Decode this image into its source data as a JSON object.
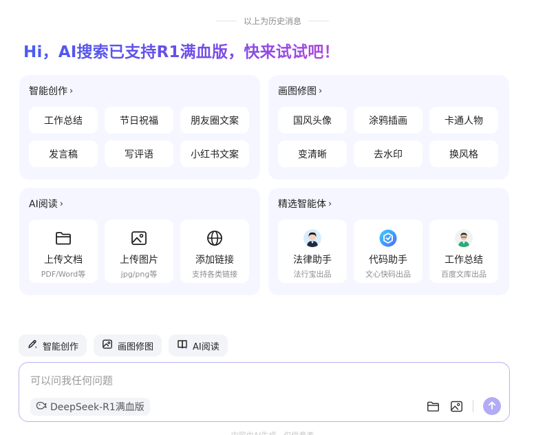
{
  "history_divider": "以上为历史消息",
  "headline": "Hi，AI搜索已支持R1满血版，快来试试吧！",
  "cards": {
    "creation": {
      "title": "智能创作",
      "chips": [
        "工作总结",
        "节日祝福",
        "朋友圈文案",
        "发言稿",
        "写评语",
        "小红书文案"
      ]
    },
    "painting": {
      "title": "画图修图",
      "chips": [
        "国风头像",
        "涂鸦插画",
        "卡通人物",
        "变清晰",
        "去水印",
        "换风格"
      ]
    },
    "reading": {
      "title": "AI阅读",
      "tiles": [
        {
          "label": "上传文档",
          "sub": "PDF/Word等",
          "icon": "folder-icon"
        },
        {
          "label": "上传图片",
          "sub": "jpg/png等",
          "icon": "image-icon"
        },
        {
          "label": "添加链接",
          "sub": "支持各类链接",
          "icon": "globe-icon"
        }
      ]
    },
    "agents": {
      "title": "精选智能体",
      "tiles": [
        {
          "label": "法律助手",
          "sub": "法行宝出品",
          "icon": "lawyer-avatar"
        },
        {
          "label": "代码助手",
          "sub": "文心快码出品",
          "icon": "code-logo"
        },
        {
          "label": "工作总结",
          "sub": "百度文库出品",
          "icon": "worker-avatar"
        }
      ]
    }
  },
  "toolbar": {
    "creation": "智能创作",
    "painting": "画图修图",
    "reading": "AI阅读"
  },
  "input": {
    "placeholder": "可以问我任何问题",
    "model": "DeepSeek-R1满血版"
  },
  "disclaimer": "内容由AI生成，仅供参考",
  "colors": {
    "accent": "#4a5cf0",
    "accent_end": "#b247e0",
    "card_bg": "#f5f6ff",
    "send_button": "#b3abf6",
    "input_border": "#b9b2f2"
  }
}
